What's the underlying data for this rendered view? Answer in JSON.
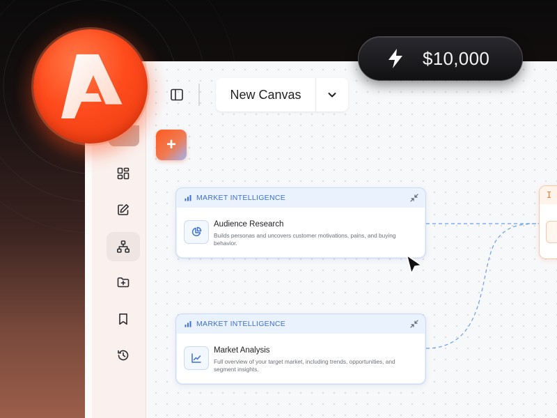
{
  "balance": {
    "amount": "$10,000",
    "icon": "lightning-bolt-icon"
  },
  "toolbar": {
    "canvas_name": "New Canvas"
  },
  "sidebar": {
    "items": [
      {
        "icon": "dashboard-grid-icon"
      },
      {
        "icon": "edit-icon"
      },
      {
        "icon": "sitemap-icon",
        "active": true
      },
      {
        "icon": "folder-plus-icon"
      },
      {
        "icon": "bookmark-icon"
      },
      {
        "icon": "history-icon"
      }
    ]
  },
  "cards": [
    {
      "category": "MARKET INTELLIGENCE",
      "title": "Audience Research",
      "description": "Builds personas and uncovers customer motivations, pains, and buying behavior.",
      "icon": "pie-chart-icon"
    },
    {
      "category": "MARKET INTELLIGENCE",
      "title": "Market Analysis",
      "description": "Full overview of your target market, including trends, opportunities, and segment insights.",
      "icon": "line-chart-icon"
    }
  ],
  "colors": {
    "brand": "#ff4b1c",
    "accent_blue": "#3d6fd6",
    "card_border": "#c9daf6"
  }
}
